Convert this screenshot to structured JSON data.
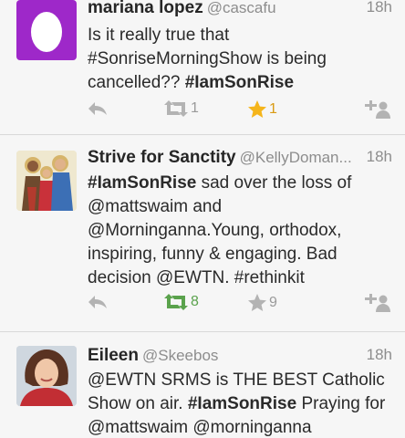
{
  "tweets": [
    {
      "name": "mariana lopez",
      "handle": "@cascafu",
      "time": "18h",
      "text_segments": [
        {
          "t": "Is it really true that #SonriseMorningShow is being cancelled?? ",
          "bold": false
        },
        {
          "t": "#IamSonRise",
          "bold": true
        }
      ],
      "retweet_count": "1",
      "favorite_count": "1",
      "retweeted": false,
      "favorited": true,
      "avatar": "egg-avatar"
    },
    {
      "name": "Strive for Sanctity",
      "handle": "@KellyDoman...",
      "time": "18h",
      "text_segments": [
        {
          "t": "#IamSonRise",
          "bold": true
        },
        {
          "t": " sad over the loss of @mattswaim and @Morninganna.Young, orthodox, inspiring, funny & engaging. Bad decision @EWTN. #rethinkit",
          "bold": false
        }
      ],
      "retweet_count": "8",
      "favorite_count": "9",
      "retweeted": true,
      "favorited": false,
      "avatar": "holy-family-avatar"
    },
    {
      "name": "Eileen",
      "handle": "@Skeebos",
      "time": "18h",
      "text_segments": [
        {
          "t": "@EWTN SRMS is THE BEST Catholic Show on air. ",
          "bold": false
        },
        {
          "t": "#IamSonRise",
          "bold": true
        },
        {
          "t": " Praying for @mattswaim @morninganna",
          "bold": false
        }
      ],
      "avatar": "woman-avatar"
    }
  ],
  "colors": {
    "retweet_active": "#5aa24c",
    "favorite_active": "#f5b51b",
    "egg_bg": "#9e28c9",
    "inactive_icon": "#b3b3b3"
  }
}
